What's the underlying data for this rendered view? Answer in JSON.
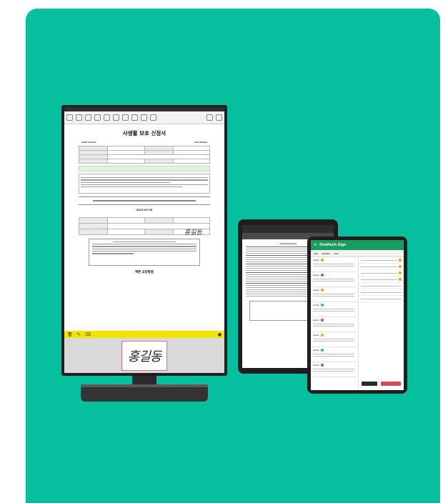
{
  "colors": {
    "background": "#06bf9f",
    "accent_green": "#1a9c5f",
    "signature_bar": "#f2e400",
    "pad_border": "#e06f8e"
  },
  "monitor": {
    "document_title": "사생활 보호 신청서",
    "hospital_name": "백튼 요양병원",
    "date": "2022 02 09",
    "signature": "홍길동"
  },
  "tablet_phone": {
    "app_name": "Onsftech Sign"
  }
}
